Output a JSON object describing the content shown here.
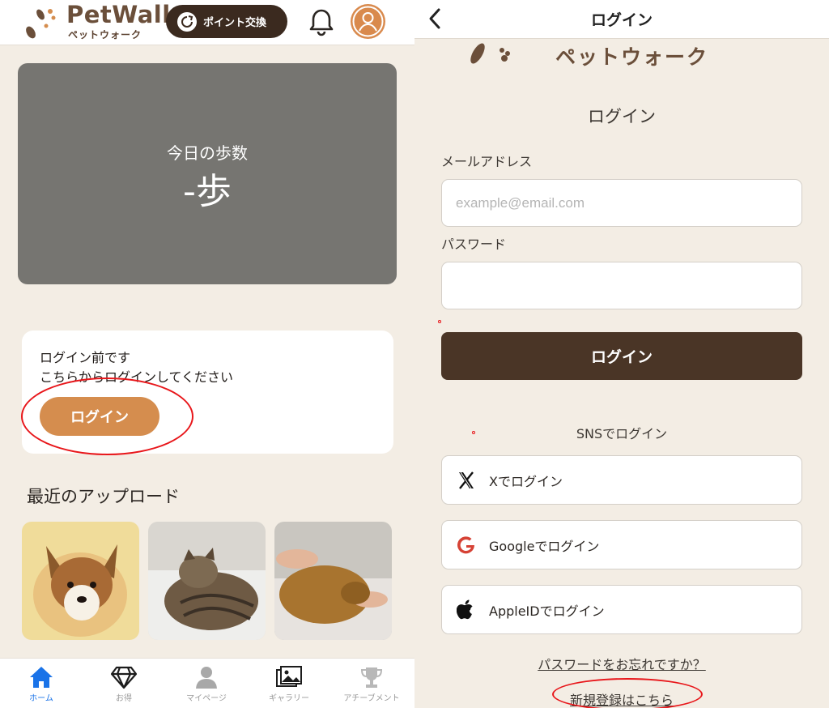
{
  "home": {
    "brand": {
      "name": "PetWall",
      "sub": "ペットウォーク"
    },
    "header": {
      "point_button": "ポイント交換"
    },
    "steps": {
      "label": "今日の歩数",
      "value": "-歩"
    },
    "login_card": {
      "line1": "ログイン前です",
      "line2": "こちらからログインしてください",
      "button": "ログイン"
    },
    "recent": {
      "title": "最近のアップロード",
      "photos": [
        "corgi-puppy",
        "sleeping-tabby-cat",
        "dog-on-lap"
      ]
    },
    "tabs": [
      {
        "label": "ホーム",
        "icon": "home-icon",
        "active": true
      },
      {
        "label": "お得",
        "icon": "diamond-icon",
        "active": false
      },
      {
        "label": "マイページ",
        "icon": "person-icon",
        "active": false
      },
      {
        "label": "ギャラリー",
        "icon": "gallery-icon",
        "active": false
      },
      {
        "label": "アチーブメント",
        "icon": "trophy-icon",
        "active": false
      }
    ]
  },
  "login": {
    "title": "ログイン",
    "brand_sub": "ペットウォーク",
    "heading": "ログイン",
    "email": {
      "label": "メールアドレス",
      "placeholder": "example@email.com",
      "value": ""
    },
    "password": {
      "label": "パスワード",
      "value": ""
    },
    "submit": "ログイン",
    "sns_heading": "SNSでログイン",
    "sns": [
      {
        "label": "Xでログイン",
        "icon": "x-logo-icon"
      },
      {
        "label": "Googleでログイン",
        "icon": "google-logo-icon"
      },
      {
        "label": "AppleIDでログイン",
        "icon": "apple-logo-icon"
      }
    ],
    "forgot": "パスワードをお忘れですか？",
    "register": "新規登録はこちら"
  },
  "colors": {
    "background": "#f3ede4",
    "accent_orange": "#d58d4e",
    "dark_brown": "#4a3526",
    "active_tab": "#1a73e8",
    "annotation_red": "#e8161a"
  }
}
